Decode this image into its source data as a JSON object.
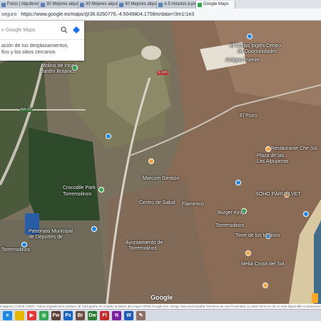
{
  "tabs": [
    {
      "label": "Fotos | Alquileres vaca"
    },
    {
      "label": "30 Mejores alquiler de"
    },
    {
      "label": "30 Mejores alquiler de"
    },
    {
      "label": "30 Mejores alquileres d"
    },
    {
      "label": "A 5 minutos a pie del"
    },
    {
      "label": "Google Maps",
      "active": true
    }
  ],
  "address": {
    "secure_label": "seguro",
    "url": "https://www.google.es/maps/@36.6260776,-4.5049804,1758m/data=!3m1!1e3"
  },
  "panel": {
    "search_placeholder": "n Google Maps",
    "info_line1": "ación de tus desplazamientos,",
    "info_line2": "fico y los sitios cercanos"
  },
  "map_labels": {
    "molino": "Molino de Inca",
    "jardin": "Jardín Botánico",
    "centro": "El Cortijo Inglés Centro",
    "oportunidades": "de Oportunidades",
    "puente": "Antiguo Puente",
    "crocodile1": "Crocodile Park",
    "crocodile2": "Torremolinos",
    "patronato": "Patronato Municipal",
    "deportes": "de Deportes de",
    "torremolinos_s": "Torremolinos",
    "ayuntamiento": "Ayuntamiento de",
    "ayunt2": "Torremolinos",
    "plaza": "Plaza de las",
    "alpujarras": "Las Alpujarras",
    "burger": "Burger King",
    "torre": "Torre de los Molinos",
    "flamenco": "Flamenco",
    "playa": "Meliá Costa del Sol",
    "el_pozo": "El Pozo",
    "restaurante": "Restaurante Che Sol",
    "oasis": "SOHO PÂRUÉLVET",
    "torremolinos_c": "Torremolinos",
    "marcom": "Marcom Gestión",
    "centro_salud": "Centro de Salud",
    "n340": "N-340",
    "a7": "MA-20"
  },
  "logo": "Google",
  "status_text": "Imágenes ©2018 CNES / Airbus,DigitalGlobe,Instituto de Cartografía de Andalucía,Datos del mapa ©2018 Google,Inst. Geogr. Nacional   España   Términos de uso   Privacidad   La vista Tierra en 30 no está disponible   Condiciones   Enviar comentarios   200 m",
  "taskbar": [
    {
      "name": "ie",
      "color": "#1e88e5",
      "label": "e"
    },
    {
      "name": "folder",
      "color": "#e6b800",
      "label": ""
    },
    {
      "name": "media",
      "color": "#e53935",
      "label": "▶"
    },
    {
      "name": "chrome",
      "color": "#34a853",
      "label": "◎"
    },
    {
      "name": "fw",
      "color": "#5d4037",
      "label": "Fw"
    },
    {
      "name": "ps",
      "color": "#1565c0",
      "label": "Ps"
    },
    {
      "name": "br",
      "color": "#6d4c41",
      "label": "Br"
    },
    {
      "name": "dw",
      "color": "#2e7d32",
      "label": "Dw"
    },
    {
      "name": "fl",
      "color": "#c62828",
      "label": "Fl"
    },
    {
      "name": "onenote",
      "color": "#7b1fa2",
      "label": "N"
    },
    {
      "name": "word",
      "color": "#1e5bb8",
      "label": "W"
    },
    {
      "name": "paint",
      "color": "#8d6e63",
      "label": "✎"
    }
  ]
}
